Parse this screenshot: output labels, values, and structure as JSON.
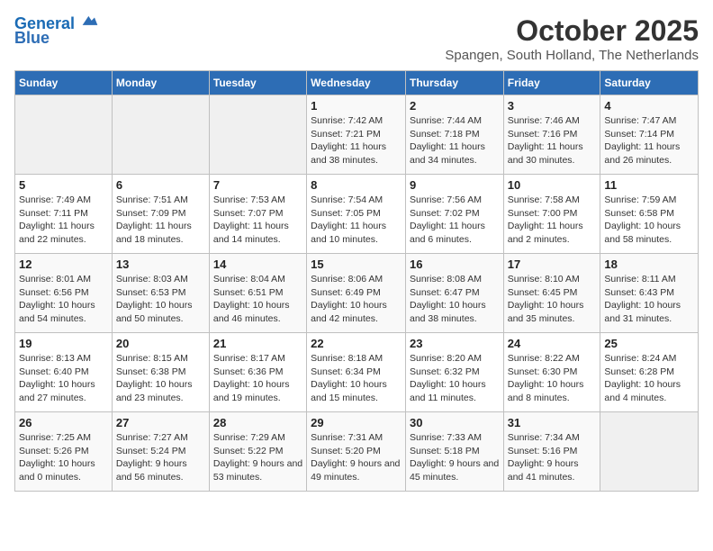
{
  "logo": {
    "line1": "General",
    "line2": "Blue"
  },
  "title": "October 2025",
  "location": "Spangen, South Holland, The Netherlands",
  "weekdays": [
    "Sunday",
    "Monday",
    "Tuesday",
    "Wednesday",
    "Thursday",
    "Friday",
    "Saturday"
  ],
  "weeks": [
    [
      {
        "day": "",
        "data": ""
      },
      {
        "day": "",
        "data": ""
      },
      {
        "day": "",
        "data": ""
      },
      {
        "day": "1",
        "data": "Sunrise: 7:42 AM\nSunset: 7:21 PM\nDaylight: 11 hours and 38 minutes."
      },
      {
        "day": "2",
        "data": "Sunrise: 7:44 AM\nSunset: 7:18 PM\nDaylight: 11 hours and 34 minutes."
      },
      {
        "day": "3",
        "data": "Sunrise: 7:46 AM\nSunset: 7:16 PM\nDaylight: 11 hours and 30 minutes."
      },
      {
        "day": "4",
        "data": "Sunrise: 7:47 AM\nSunset: 7:14 PM\nDaylight: 11 hours and 26 minutes."
      }
    ],
    [
      {
        "day": "5",
        "data": "Sunrise: 7:49 AM\nSunset: 7:11 PM\nDaylight: 11 hours and 22 minutes."
      },
      {
        "day": "6",
        "data": "Sunrise: 7:51 AM\nSunset: 7:09 PM\nDaylight: 11 hours and 18 minutes."
      },
      {
        "day": "7",
        "data": "Sunrise: 7:53 AM\nSunset: 7:07 PM\nDaylight: 11 hours and 14 minutes."
      },
      {
        "day": "8",
        "data": "Sunrise: 7:54 AM\nSunset: 7:05 PM\nDaylight: 11 hours and 10 minutes."
      },
      {
        "day": "9",
        "data": "Sunrise: 7:56 AM\nSunset: 7:02 PM\nDaylight: 11 hours and 6 minutes."
      },
      {
        "day": "10",
        "data": "Sunrise: 7:58 AM\nSunset: 7:00 PM\nDaylight: 11 hours and 2 minutes."
      },
      {
        "day": "11",
        "data": "Sunrise: 7:59 AM\nSunset: 6:58 PM\nDaylight: 10 hours and 58 minutes."
      }
    ],
    [
      {
        "day": "12",
        "data": "Sunrise: 8:01 AM\nSunset: 6:56 PM\nDaylight: 10 hours and 54 minutes."
      },
      {
        "day": "13",
        "data": "Sunrise: 8:03 AM\nSunset: 6:53 PM\nDaylight: 10 hours and 50 minutes."
      },
      {
        "day": "14",
        "data": "Sunrise: 8:04 AM\nSunset: 6:51 PM\nDaylight: 10 hours and 46 minutes."
      },
      {
        "day": "15",
        "data": "Sunrise: 8:06 AM\nSunset: 6:49 PM\nDaylight: 10 hours and 42 minutes."
      },
      {
        "day": "16",
        "data": "Sunrise: 8:08 AM\nSunset: 6:47 PM\nDaylight: 10 hours and 38 minutes."
      },
      {
        "day": "17",
        "data": "Sunrise: 8:10 AM\nSunset: 6:45 PM\nDaylight: 10 hours and 35 minutes."
      },
      {
        "day": "18",
        "data": "Sunrise: 8:11 AM\nSunset: 6:43 PM\nDaylight: 10 hours and 31 minutes."
      }
    ],
    [
      {
        "day": "19",
        "data": "Sunrise: 8:13 AM\nSunset: 6:40 PM\nDaylight: 10 hours and 27 minutes."
      },
      {
        "day": "20",
        "data": "Sunrise: 8:15 AM\nSunset: 6:38 PM\nDaylight: 10 hours and 23 minutes."
      },
      {
        "day": "21",
        "data": "Sunrise: 8:17 AM\nSunset: 6:36 PM\nDaylight: 10 hours and 19 minutes."
      },
      {
        "day": "22",
        "data": "Sunrise: 8:18 AM\nSunset: 6:34 PM\nDaylight: 10 hours and 15 minutes."
      },
      {
        "day": "23",
        "data": "Sunrise: 8:20 AM\nSunset: 6:32 PM\nDaylight: 10 hours and 11 minutes."
      },
      {
        "day": "24",
        "data": "Sunrise: 8:22 AM\nSunset: 6:30 PM\nDaylight: 10 hours and 8 minutes."
      },
      {
        "day": "25",
        "data": "Sunrise: 8:24 AM\nSunset: 6:28 PM\nDaylight: 10 hours and 4 minutes."
      }
    ],
    [
      {
        "day": "26",
        "data": "Sunrise: 7:25 AM\nSunset: 5:26 PM\nDaylight: 10 hours and 0 minutes."
      },
      {
        "day": "27",
        "data": "Sunrise: 7:27 AM\nSunset: 5:24 PM\nDaylight: 9 hours and 56 minutes."
      },
      {
        "day": "28",
        "data": "Sunrise: 7:29 AM\nSunset: 5:22 PM\nDaylight: 9 hours and 53 minutes."
      },
      {
        "day": "29",
        "data": "Sunrise: 7:31 AM\nSunset: 5:20 PM\nDaylight: 9 hours and 49 minutes."
      },
      {
        "day": "30",
        "data": "Sunrise: 7:33 AM\nSunset: 5:18 PM\nDaylight: 9 hours and 45 minutes."
      },
      {
        "day": "31",
        "data": "Sunrise: 7:34 AM\nSunset: 5:16 PM\nDaylight: 9 hours and 41 minutes."
      },
      {
        "day": "",
        "data": ""
      }
    ]
  ]
}
